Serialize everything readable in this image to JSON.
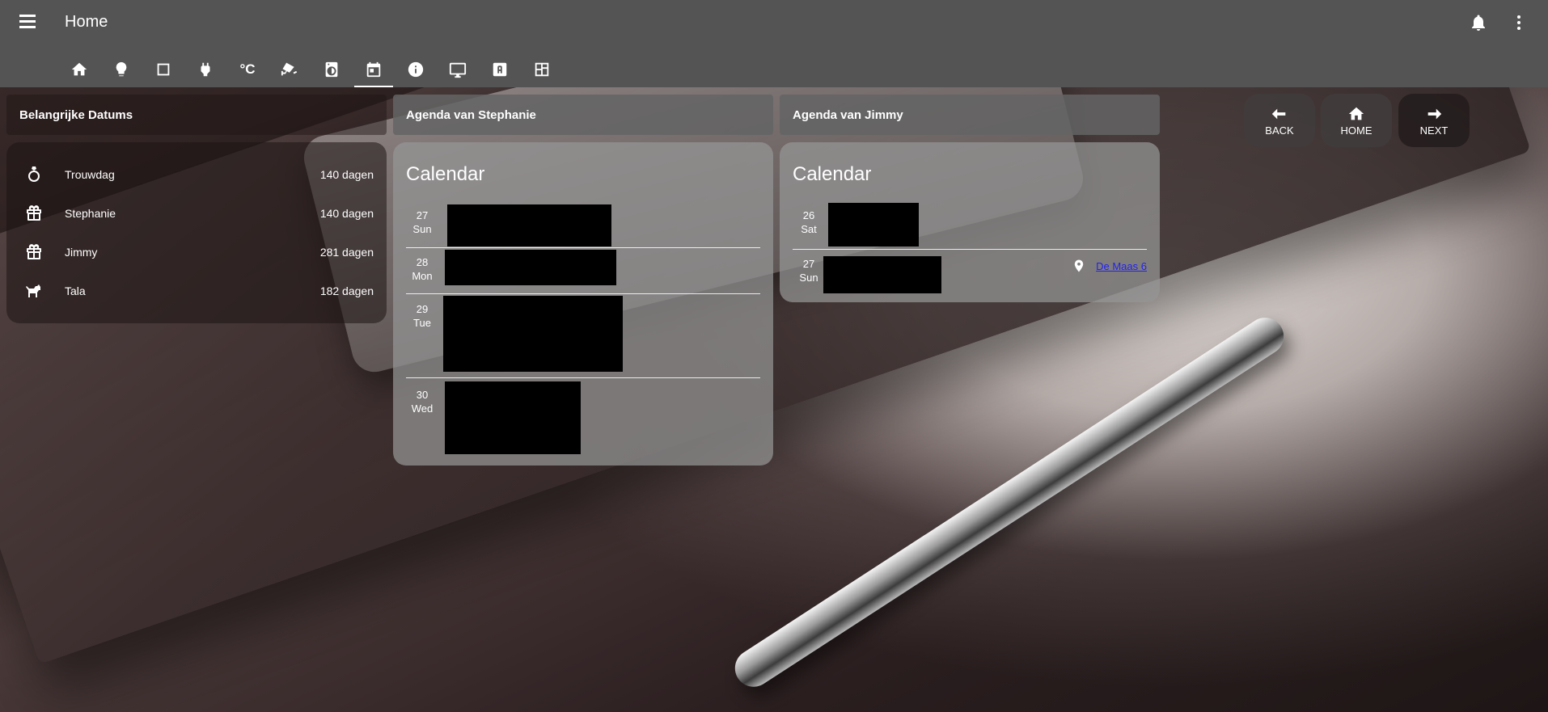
{
  "header": {
    "title": "Home",
    "tabs": [
      {
        "icon": "home-icon"
      },
      {
        "icon": "lightbulb-icon"
      },
      {
        "icon": "square-icon"
      },
      {
        "icon": "plug-icon"
      },
      {
        "icon": "temperature-icon",
        "text": "°C"
      },
      {
        "icon": "cctv-icon"
      },
      {
        "icon": "washing-machine-icon"
      },
      {
        "icon": "calendar-icon",
        "active": true
      },
      {
        "icon": "info-icon"
      },
      {
        "icon": "monitor-icon"
      },
      {
        "icon": "letter-a-icon"
      },
      {
        "icon": "floorplan-icon"
      }
    ]
  },
  "dates_card": {
    "title": "Belangrijke Datums",
    "items": [
      {
        "icon": "ring-icon",
        "name": "Trouwdag",
        "value": "140 dagen"
      },
      {
        "icon": "gift-icon",
        "name": "Stephanie",
        "value": "140 dagen"
      },
      {
        "icon": "gift-icon",
        "name": "Jimmy",
        "value": "281 dagen"
      },
      {
        "icon": "dog-icon",
        "name": "Tala",
        "value": "182 dagen"
      }
    ]
  },
  "agenda_stephanie": {
    "title": "Agenda van Stephanie",
    "calendar_title": "Calendar",
    "days": [
      {
        "num": "27",
        "dow": "Sun"
      },
      {
        "num": "28",
        "dow": "Mon"
      },
      {
        "num": "29",
        "dow": "Tue"
      },
      {
        "num": "30",
        "dow": "Wed"
      }
    ]
  },
  "agenda_jimmy": {
    "title": "Agenda van Jimmy",
    "calendar_title": "Calendar",
    "days": [
      {
        "num": "26",
        "dow": "Sat"
      },
      {
        "num": "27",
        "dow": "Sun",
        "location": "De Maas 6"
      }
    ]
  },
  "nav": {
    "back": "BACK",
    "home": "HOME",
    "next": "NEXT"
  }
}
